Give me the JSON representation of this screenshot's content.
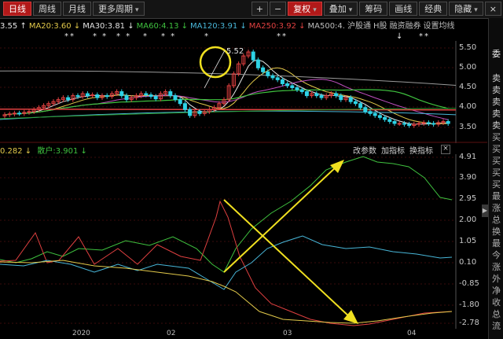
{
  "toolbar": {
    "left_buttons": [
      {
        "label": "日线",
        "active": true
      },
      {
        "label": "周线",
        "active": false
      },
      {
        "label": "月线",
        "active": false
      },
      {
        "label": "更多周期",
        "active": false,
        "dropdown": true
      }
    ],
    "right_buttons": [
      {
        "label": "+",
        "active": false
      },
      {
        "label": "−",
        "active": false
      },
      {
        "label": "复权",
        "active": true,
        "dropdown": true
      },
      {
        "label": "叠加",
        "active": false,
        "dropdown": true
      },
      {
        "label": "筹码",
        "active": false
      },
      {
        "label": "画线",
        "active": false
      },
      {
        "label": "经典",
        "active": false
      },
      {
        "label": "隐藏",
        "active": false,
        "dropdown": true
      },
      {
        "label": "×",
        "active": false
      }
    ]
  },
  "ma_bar": [
    {
      "text": "3.55 ↑",
      "color": "#e6e6e6"
    },
    {
      "text": "MA20:3.60 ↓",
      "color": "#e2c94a"
    },
    {
      "text": "MA30:3.81 ↓",
      "color": "#e2e2e2"
    },
    {
      "text": "MA60:4.13 ↓",
      "color": "#3fc23f"
    },
    {
      "text": "MA120:3.91 ↓",
      "color": "#48b6d8"
    },
    {
      "text": "MA250:3.92 ↓",
      "color": "#e04040"
    },
    {
      "text": "MA500:4.",
      "color": "#bdbdbd"
    },
    {
      "text": "沪股通",
      "color": "#bdbdbd"
    },
    {
      "text": "H股",
      "color": "#bdbdbd"
    },
    {
      "text": "融资融券",
      "color": "#bdbdbd"
    },
    {
      "text": "设置均线",
      "color": "#bdbdbd",
      "dropdown": true
    }
  ],
  "star_marks": [
    "**",
    "* *",
    "* *",
    "*",
    "* *",
    "*",
    "**",
    "↓",
    "**"
  ],
  "price_axis": [
    "5.50",
    "5.00",
    "4.50",
    "4.00",
    "3.50"
  ],
  "price_annotation": "5.52",
  "indicator_bar": {
    "value_1": "0.282 ↓",
    "value_1_color": "#e2c94a",
    "value_2": "散户:3.901 ↓",
    "value_2_color": "#3fc23f"
  },
  "indicator_buttons": [
    "改参数",
    "加指标",
    "换指标"
  ],
  "indicator_close": "×",
  "indicator_axis": [
    "4.91",
    "3.90",
    "2.95",
    "2.00",
    "1.05",
    "0.10",
    "-0.85",
    "-1.80",
    "-2.78"
  ],
  "x_axis": [
    "2020",
    "02",
    "03",
    "04"
  ],
  "right_panel": [
    "委",
    "卖",
    "卖",
    "卖",
    "卖",
    "卖",
    "买",
    "买",
    "买",
    "买",
    "买",
    "最",
    "涨",
    "总",
    "换",
    "最",
    "今",
    "涨",
    "外",
    "净",
    "收",
    "总",
    "流"
  ],
  "colors": {
    "background": "#000000",
    "active_button": "#b21919",
    "up_candle": "#e04040",
    "down_candle": "#2ed3e6",
    "ma5": "#e6e6e6",
    "ma20": "#e2c94a",
    "ma30": "#c04fc0",
    "ma60": "#3fc23f",
    "ma250": "#e04040",
    "ma500": "#9a9a9a",
    "highlight_circle": "#f0e020",
    "arrow": "#f0e020"
  }
}
